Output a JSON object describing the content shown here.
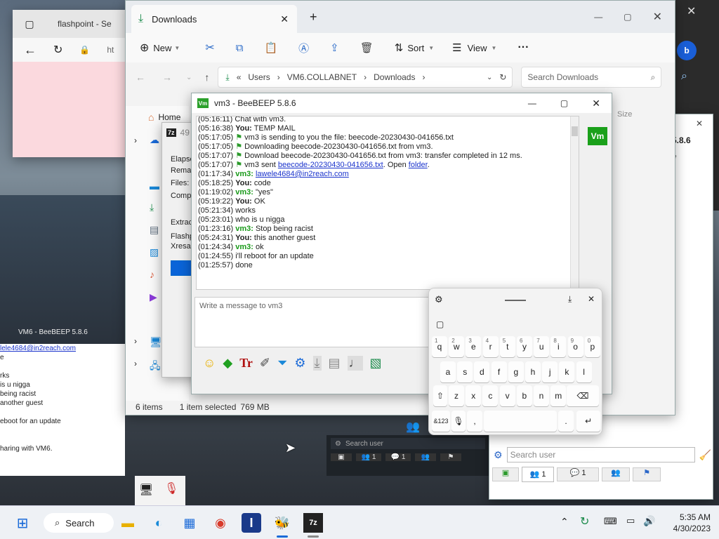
{
  "browser": {
    "tab_title": "flashpoint - Se",
    "address_prefix": "ht"
  },
  "explorer": {
    "title": "Downloads",
    "toolbar": {
      "new": "New",
      "sort": "Sort",
      "view": "View",
      "more": "···"
    },
    "breadcrumb": [
      "Users",
      "VM6.COLLABNET",
      "Downloads"
    ],
    "search_placeholder": "Search Downloads",
    "nav_home": "Home",
    "status": {
      "count": "6 items",
      "selected": "1 item selected",
      "size": "769 MB"
    },
    "col_size": "Size"
  },
  "sevenzip": {
    "icon_label": "7z",
    "title_num": "49",
    "labels": [
      "Elapse",
      "Remai",
      "Files:",
      "Compr",
      "Extract",
      "Flashp",
      "Xresag"
    ]
  },
  "beebeep": {
    "title": "vm3 - BeeBEEP 5.8.6",
    "app_badge": "Vm",
    "input_placeholder": "Write a message to vm3",
    "lines": [
      {
        "time": "(05:16:11)",
        "who": "",
        "text": "Chat with vm3."
      },
      {
        "time": "(05:16:38)",
        "who": "You:",
        "cls": "me",
        "text": "TEMP MAIL"
      },
      {
        "time": "(05:17:05)",
        "who": "",
        "icon": true,
        "text": "vm3 is sending to you the file: beecode-20230430-041656.txt"
      },
      {
        "time": "(05:17:05)",
        "who": "",
        "icon": true,
        "text": "Downloading beecode-20230430-041656.txt from vm3."
      },
      {
        "time": "(05:17:07)",
        "who": "",
        "icon": true,
        "text": "Download beecode-20230430-041656.txt from vm3: transfer completed in 12 ms."
      },
      {
        "time": "(05:17:07)",
        "who": "",
        "icon": true,
        "text": "vm3 sent ",
        "link": "beecode-20230430-041656.txt",
        "after": ". Open ",
        "link2": "folder",
        "after2": "."
      },
      {
        "time": "(01:17:34)",
        "who": "vm3:",
        "cls": "vm",
        "text": "",
        "link": "lawele4684@in2reach.com"
      },
      {
        "time": "(05:18:25)",
        "who": "You:",
        "cls": "me",
        "text": "code"
      },
      {
        "time": "(01:19:02)",
        "who": "vm3:",
        "cls": "vm",
        "text": "\"yes\""
      },
      {
        "time": "(05:19:22)",
        "who": "You:",
        "cls": "me",
        "text": "OK"
      },
      {
        "time": "(05:21:34)",
        "who": "",
        "text": "  works"
      },
      {
        "time": "(05:23:01)",
        "who": "",
        "text": "  who is u nigga"
      },
      {
        "time": "(01:23:16)",
        "who": "vm3:",
        "cls": "vm",
        "text": "Stop being racist"
      },
      {
        "time": "(05:24:31)",
        "who": "You:",
        "cls": "me",
        "text": "this another guest"
      },
      {
        "time": "(01:24:34)",
        "who": "vm3:",
        "cls": "vm",
        "text": "ok"
      },
      {
        "time": "(01:24:55)",
        "who": "",
        "text": "  i'll reboot for an update"
      },
      {
        "time": "(01:25:57)",
        "who": "",
        "text": "  done"
      }
    ]
  },
  "beebeep_main": {
    "version": "5.8.6",
    "search_placeholder": "Search user",
    "tabs": [
      {
        "label": "",
        "icon": "green-screen-icon"
      },
      {
        "label": "1",
        "icon": "users-icon"
      },
      {
        "label": "1",
        "icon": "chat-icon"
      },
      {
        "label": "",
        "icon": "groups-icon"
      },
      {
        "label": "",
        "icon": "flag-icon"
      }
    ]
  },
  "background_window": {
    "title": "VM6 - BeeBEEP 5.8.6",
    "lines": [
      "lele4684@in2reach.com",
      "e",
      "",
      "rks",
      "is u nigga",
      "being racist",
      "another guest",
      "",
      "eboot for an update",
      "",
      "",
      "haring with VM6."
    ],
    "search_placeholder": "Search user",
    "tabs": [
      "1",
      "1"
    ]
  },
  "keyboard": {
    "rows": [
      [
        {
          "k": "q",
          "n": "1"
        },
        {
          "k": "w",
          "n": "2"
        },
        {
          "k": "e",
          "n": "3"
        },
        {
          "k": "r",
          "n": "4"
        },
        {
          "k": "t",
          "n": "5"
        },
        {
          "k": "y",
          "n": "6"
        },
        {
          "k": "u",
          "n": "7"
        },
        {
          "k": "i",
          "n": "8"
        },
        {
          "k": "o",
          "n": "9"
        },
        {
          "k": "p",
          "n": "0"
        }
      ],
      [
        {
          "k": "a"
        },
        {
          "k": "s"
        },
        {
          "k": "d"
        },
        {
          "k": "f"
        },
        {
          "k": "g"
        },
        {
          "k": "h"
        },
        {
          "k": "j"
        },
        {
          "k": "k"
        },
        {
          "k": "l"
        }
      ],
      [
        {
          "k": "z"
        },
        {
          "k": "x"
        },
        {
          "k": "c"
        },
        {
          "k": "v"
        },
        {
          "k": "b"
        },
        {
          "k": "n"
        },
        {
          "k": "m"
        }
      ]
    ],
    "sym_label": "&123",
    "comma": ",",
    "period": "."
  },
  "taskbar": {
    "search": "Search",
    "time": "5:35 AM",
    "date": "4/30/2023",
    "sevenzip_label": "7z"
  }
}
